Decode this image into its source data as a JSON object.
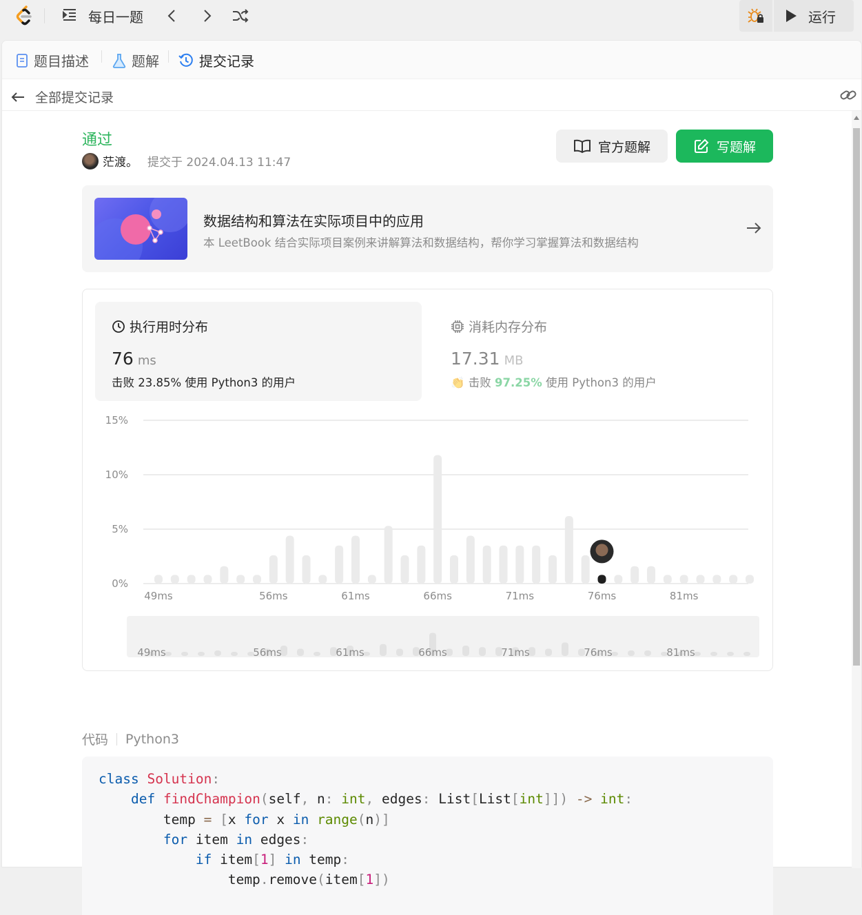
{
  "topbar": {
    "daily_label": "每日一题",
    "run_label": "运行"
  },
  "tabs": [
    {
      "label": "题目描述",
      "icon": "document-icon"
    },
    {
      "label": "题解",
      "icon": "flask-icon"
    },
    {
      "label": "提交记录",
      "icon": "history-icon"
    }
  ],
  "subheader": {
    "back_label": "全部提交记录"
  },
  "submission": {
    "status": "通过",
    "username": "茫渡。",
    "submitted_at": "提交于 2024.04.13 11:47",
    "official_solution_label": "官方题解",
    "write_solution_label": "写题解"
  },
  "promo": {
    "title": "数据结构和算法在实际项目中的应用",
    "subtitle": "本 LeetBook 结合实际项目案例来讲解算法和数据结构，帮你学习掌握算法和数据结构"
  },
  "runtime": {
    "title": "执行用时分布",
    "value": "76",
    "unit": "ms",
    "beat_prefix": "击败",
    "beat_pct": "23.85%",
    "beat_suffix": "使用 Python3 的用户"
  },
  "memory": {
    "title": "消耗内存分布",
    "value": "17.31",
    "unit": "MB",
    "beat_prefix": "击败",
    "beat_pct": "97.25%",
    "beat_suffix": "使用 Python3 的用户"
  },
  "chart_data": {
    "type": "bar",
    "ylabel": "",
    "xlabel": "",
    "ylim": [
      0,
      15
    ],
    "yticks": [
      "15%",
      "10%",
      "5%",
      "0%"
    ],
    "ytick_values": [
      15,
      10,
      5,
      0
    ],
    "categories": [
      "49ms",
      "50ms",
      "51ms",
      "52ms",
      "53ms",
      "54ms",
      "55ms",
      "56ms",
      "57ms",
      "58ms",
      "59ms",
      "60ms",
      "61ms",
      "62ms",
      "63ms",
      "64ms",
      "65ms",
      "66ms",
      "67ms",
      "68ms",
      "69ms",
      "70ms",
      "71ms",
      "72ms",
      "73ms",
      "74ms",
      "75ms",
      "76ms",
      "77ms",
      "78ms",
      "79ms",
      "80ms",
      "81ms",
      "82ms",
      "83ms",
      "84ms",
      "85ms"
    ],
    "xtick_labels": [
      "49ms",
      "56ms",
      "61ms",
      "66ms",
      "71ms",
      "76ms",
      "81ms"
    ],
    "values": [
      0.8,
      0.8,
      0.8,
      0.8,
      1.6,
      0.8,
      0.8,
      2.6,
      4.4,
      2.6,
      0.8,
      3.5,
      4.4,
      0.8,
      5.3,
      2.6,
      3.5,
      11.8,
      2.6,
      4.4,
      3.5,
      3.5,
      3.5,
      3.5,
      2.6,
      6.2,
      2.6,
      0.8,
      0.8,
      1.6,
      1.6,
      0.8,
      0.8,
      0.8,
      0.8,
      0.8,
      0.8
    ],
    "highlight_category": "76ms"
  },
  "code": {
    "label": "代码",
    "language": "Python3"
  }
}
